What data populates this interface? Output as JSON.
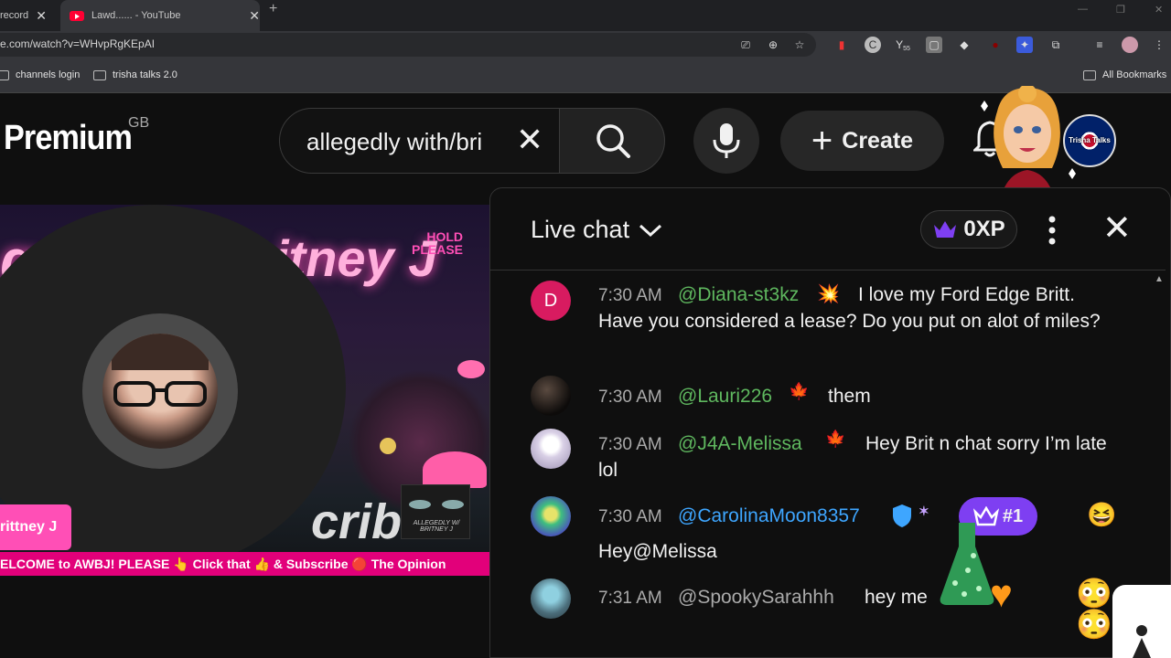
{
  "browser": {
    "tabs": [
      {
        "title": "record"
      },
      {
        "title": "Lawd...... - YouTube"
      }
    ],
    "url": "e.com/watch?v=WHvpRgKEpAI",
    "bookmarks": [
      {
        "label": "channels login"
      },
      {
        "label": "trisha talks 2.0"
      },
      {
        "label": "All Bookmarks"
      }
    ],
    "extension_badge": "55"
  },
  "header": {
    "logo": "Premium",
    "country": "GB",
    "search_value": "allegedly with/bri",
    "create_label": "Create",
    "avatar_text": "Trisha Talks"
  },
  "video": {
    "overlay_title_left": "ge",
    "overlay_title_right": "itney J",
    "hold_label": "HOLD\nPLEASE",
    "name_badge": "rittney J",
    "subscribe_text": "cribe!",
    "ticker": "ELCOME to AWBJ! PLEASE 👆 Click that 👍 & Subscribe 🔴 The Opinion",
    "thumb_caption": "ALLEGEDLY W/ BRITNEY J"
  },
  "chat": {
    "title": "Live chat",
    "xp": "0XP",
    "rank_badge": "#1",
    "messages": [
      {
        "initial": "D",
        "avatar_color": "#d81b60",
        "time": "7:30 AM",
        "author": "@Diana-st3kz",
        "author_color": "#5fb85f",
        "text": "I love my Ford Edge Britt. Have you considered a lease? Do you put on alot of miles?"
      },
      {
        "initial": "",
        "avatar_color": "#2a2420",
        "time": "7:30 AM",
        "author": "@Lauri226",
        "author_color": "#5fb85f",
        "text": "them"
      },
      {
        "initial": "",
        "avatar_color": "#d9d0e6",
        "time": "7:30 AM",
        "author": "@J4A-Melissa",
        "author_color": "#5fb85f",
        "text": "Hey Brit n chat sorry I’m late lol"
      },
      {
        "initial": "",
        "avatar_color": "#4a5bb8",
        "time": "7:30 AM",
        "author": "@CarolinaMoon8357",
        "author_color": "#3ea6ff",
        "text": "Hey@Melissa"
      },
      {
        "initial": "",
        "avatar_color": "#4b6d7a",
        "time": "7:31 AM",
        "author": "@SpookySarahhh",
        "author_color": "#aaaaaa",
        "text": "hey me"
      }
    ]
  },
  "colors": {
    "accent_pink": "#ff4fb6",
    "ticker_bg": "#e2007a",
    "crown_purple": "#7e3ff2",
    "member_green": "#5fb85f",
    "moderator_blue": "#3ea6ff"
  },
  "icons": [
    "close-icon",
    "new-tab-icon",
    "folder-icon",
    "search-icon",
    "mic-icon",
    "plus-icon",
    "bell-icon",
    "chevron-down-icon",
    "crown-icon",
    "more-vert-icon",
    "verified-shield-icon",
    "scroll-up-icon"
  ]
}
